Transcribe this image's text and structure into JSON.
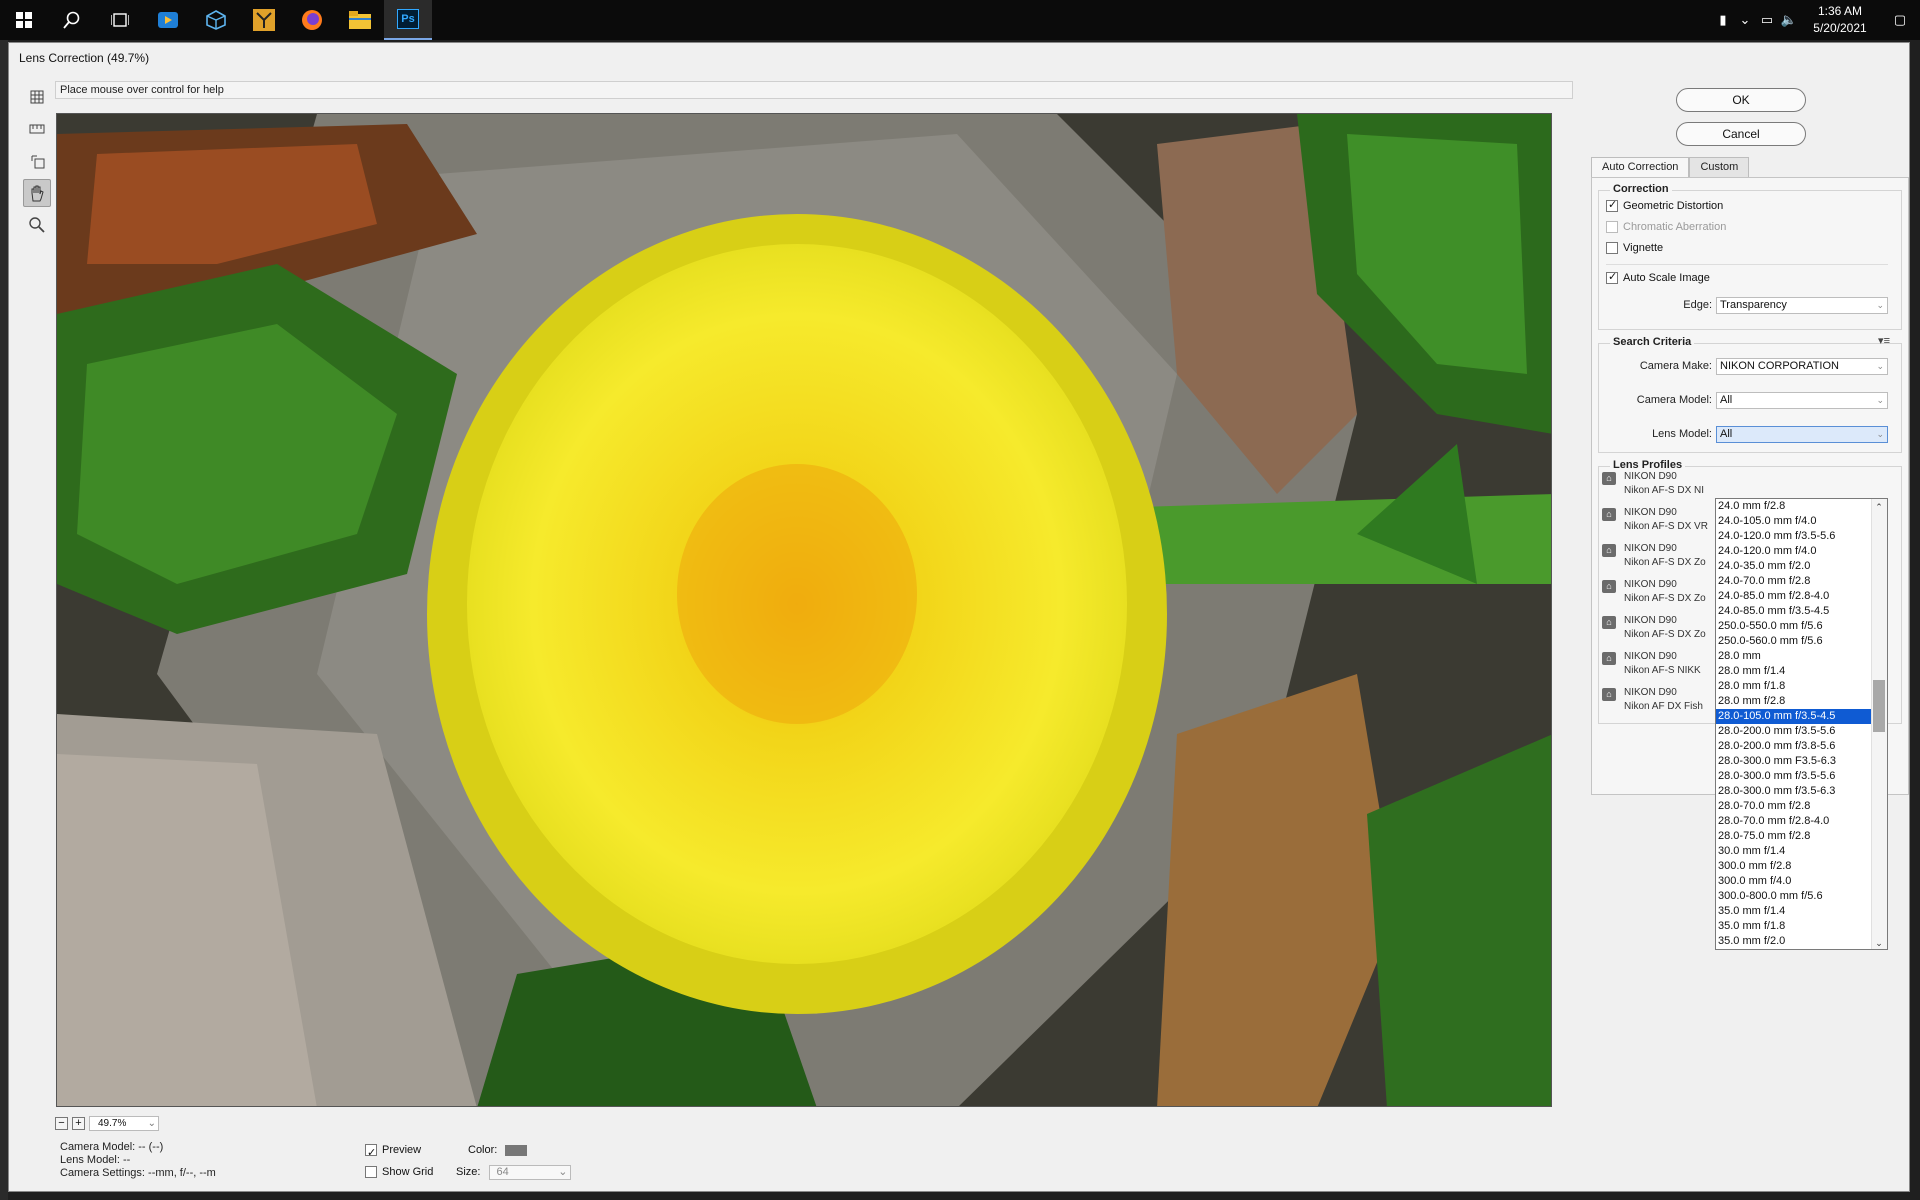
{
  "taskbar": {
    "apps": [
      "start-icon",
      "search-icon",
      "task-view-icon",
      "media-player-icon",
      "3d-viewer-icon",
      "app-icon",
      "firefox-icon",
      "file-explorer-icon",
      "photoshop-icon"
    ],
    "ps_label": "Ps",
    "time": "1:36 AM",
    "date": "5/20/2021"
  },
  "dialog": {
    "title": "Lens Correction (49.7%)",
    "help": "Place mouse over control for help",
    "zoom": "49.7%",
    "camera_model": "Camera Model: -- (--)",
    "lens_model": "Lens Model: --",
    "camera_settings": "Camera Settings: --mm, f/--, --m",
    "preview_label": "Preview",
    "show_grid_label": "Show Grid",
    "color_label": "Color:",
    "size_label": "Size:",
    "size_value": "64"
  },
  "buttons": {
    "ok": "OK",
    "cancel": "Cancel"
  },
  "tabs": [
    "Auto Correction",
    "Custom"
  ],
  "correction": {
    "title": "Correction",
    "geometric": "Geometric Distortion",
    "chromatic": "Chromatic Aberration",
    "vignette": "Vignette",
    "auto_scale": "Auto Scale Image",
    "edge_label": "Edge:",
    "edge_value": "Transparency"
  },
  "search": {
    "title": "Search Criteria",
    "make_label": "Camera Make:",
    "make_value": "NIKON CORPORATION",
    "model_label": "Camera Model:",
    "model_value": "All",
    "lens_label": "Lens Model:",
    "lens_value": "All"
  },
  "lens_profiles": {
    "title": "Lens Profiles",
    "items": [
      {
        "name": "NIKON D90",
        "sub": "Nikon AF-S DX NI"
      },
      {
        "name": "NIKON D90",
        "sub": "Nikon AF-S DX VR"
      },
      {
        "name": "NIKON D90",
        "sub": "Nikon AF-S DX Zo"
      },
      {
        "name": "NIKON D90",
        "sub": "Nikon AF-S DX Zo"
      },
      {
        "name": "NIKON D90",
        "sub": "Nikon AF-S DX Zo"
      },
      {
        "name": "NIKON D90",
        "sub": "Nikon AF-S NIKK"
      },
      {
        "name": "NIKON D90",
        "sub": "Nikon AF DX Fish"
      }
    ]
  },
  "lens_dropdown": {
    "selected_index": 14,
    "items": [
      "24.0 mm f/2.8",
      "24.0-105.0 mm f/4.0",
      "24.0-120.0 mm f/3.5-5.6",
      "24.0-120.0 mm f/4.0",
      "24.0-35.0 mm f/2.0",
      "24.0-70.0 mm f/2.8",
      "24.0-85.0 mm f/2.8-4.0",
      "24.0-85.0 mm f/3.5-4.5",
      "250.0-550.0 mm f/5.6",
      "250.0-560.0 mm f/5.6",
      "28.0 mm",
      "28.0 mm f/1.4",
      "28.0 mm f/1.8",
      "28.0 mm f/2.8",
      "28.0-105.0 mm f/3.5-4.5",
      "28.0-200.0 mm f/3.5-5.6",
      "28.0-200.0 mm f/3.8-5.6",
      "28.0-300.0 mm F3.5-6.3",
      "28.0-300.0 mm f/3.5-5.6",
      "28.0-300.0 mm f/3.5-6.3",
      "28.0-70.0 mm f/2.8",
      "28.0-70.0 mm f/2.8-4.0",
      "28.0-75.0 mm f/2.8",
      "30.0 mm f/1.4",
      "300.0 mm f/2.8",
      "300.0 mm f/4.0",
      "300.0-800.0 mm f/5.6",
      "35.0 mm f/1.4",
      "35.0 mm f/1.8",
      "35.0 mm f/2.0"
    ]
  }
}
